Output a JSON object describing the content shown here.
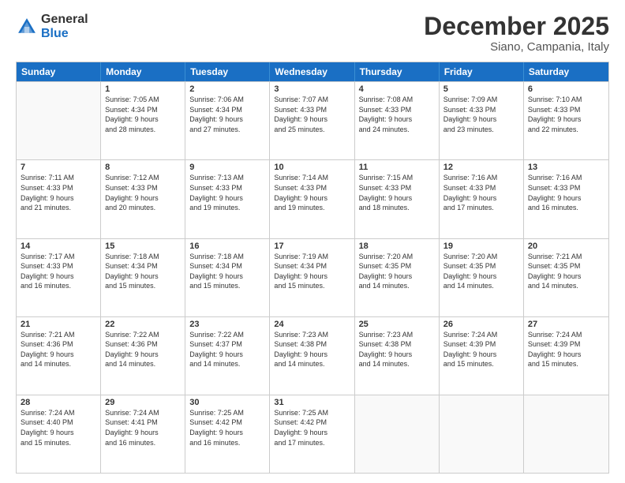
{
  "logo": {
    "general": "General",
    "blue": "Blue"
  },
  "title": "December 2025",
  "subtitle": "Siano, Campania, Italy",
  "days": [
    "Sunday",
    "Monday",
    "Tuesday",
    "Wednesday",
    "Thursday",
    "Friday",
    "Saturday"
  ],
  "rows": [
    [
      {
        "day": "",
        "info": ""
      },
      {
        "day": "1",
        "info": "Sunrise: 7:05 AM\nSunset: 4:34 PM\nDaylight: 9 hours\nand 28 minutes."
      },
      {
        "day": "2",
        "info": "Sunrise: 7:06 AM\nSunset: 4:34 PM\nDaylight: 9 hours\nand 27 minutes."
      },
      {
        "day": "3",
        "info": "Sunrise: 7:07 AM\nSunset: 4:33 PM\nDaylight: 9 hours\nand 25 minutes."
      },
      {
        "day": "4",
        "info": "Sunrise: 7:08 AM\nSunset: 4:33 PM\nDaylight: 9 hours\nand 24 minutes."
      },
      {
        "day": "5",
        "info": "Sunrise: 7:09 AM\nSunset: 4:33 PM\nDaylight: 9 hours\nand 23 minutes."
      },
      {
        "day": "6",
        "info": "Sunrise: 7:10 AM\nSunset: 4:33 PM\nDaylight: 9 hours\nand 22 minutes."
      }
    ],
    [
      {
        "day": "7",
        "info": "Sunrise: 7:11 AM\nSunset: 4:33 PM\nDaylight: 9 hours\nand 21 minutes."
      },
      {
        "day": "8",
        "info": "Sunrise: 7:12 AM\nSunset: 4:33 PM\nDaylight: 9 hours\nand 20 minutes."
      },
      {
        "day": "9",
        "info": "Sunrise: 7:13 AM\nSunset: 4:33 PM\nDaylight: 9 hours\nand 19 minutes."
      },
      {
        "day": "10",
        "info": "Sunrise: 7:14 AM\nSunset: 4:33 PM\nDaylight: 9 hours\nand 19 minutes."
      },
      {
        "day": "11",
        "info": "Sunrise: 7:15 AM\nSunset: 4:33 PM\nDaylight: 9 hours\nand 18 minutes."
      },
      {
        "day": "12",
        "info": "Sunrise: 7:16 AM\nSunset: 4:33 PM\nDaylight: 9 hours\nand 17 minutes."
      },
      {
        "day": "13",
        "info": "Sunrise: 7:16 AM\nSunset: 4:33 PM\nDaylight: 9 hours\nand 16 minutes."
      }
    ],
    [
      {
        "day": "14",
        "info": "Sunrise: 7:17 AM\nSunset: 4:33 PM\nDaylight: 9 hours\nand 16 minutes."
      },
      {
        "day": "15",
        "info": "Sunrise: 7:18 AM\nSunset: 4:34 PM\nDaylight: 9 hours\nand 15 minutes."
      },
      {
        "day": "16",
        "info": "Sunrise: 7:18 AM\nSunset: 4:34 PM\nDaylight: 9 hours\nand 15 minutes."
      },
      {
        "day": "17",
        "info": "Sunrise: 7:19 AM\nSunset: 4:34 PM\nDaylight: 9 hours\nand 15 minutes."
      },
      {
        "day": "18",
        "info": "Sunrise: 7:20 AM\nSunset: 4:35 PM\nDaylight: 9 hours\nand 14 minutes."
      },
      {
        "day": "19",
        "info": "Sunrise: 7:20 AM\nSunset: 4:35 PM\nDaylight: 9 hours\nand 14 minutes."
      },
      {
        "day": "20",
        "info": "Sunrise: 7:21 AM\nSunset: 4:35 PM\nDaylight: 9 hours\nand 14 minutes."
      }
    ],
    [
      {
        "day": "21",
        "info": "Sunrise: 7:21 AM\nSunset: 4:36 PM\nDaylight: 9 hours\nand 14 minutes."
      },
      {
        "day": "22",
        "info": "Sunrise: 7:22 AM\nSunset: 4:36 PM\nDaylight: 9 hours\nand 14 minutes."
      },
      {
        "day": "23",
        "info": "Sunrise: 7:22 AM\nSunset: 4:37 PM\nDaylight: 9 hours\nand 14 minutes."
      },
      {
        "day": "24",
        "info": "Sunrise: 7:23 AM\nSunset: 4:38 PM\nDaylight: 9 hours\nand 14 minutes."
      },
      {
        "day": "25",
        "info": "Sunrise: 7:23 AM\nSunset: 4:38 PM\nDaylight: 9 hours\nand 14 minutes."
      },
      {
        "day": "26",
        "info": "Sunrise: 7:24 AM\nSunset: 4:39 PM\nDaylight: 9 hours\nand 15 minutes."
      },
      {
        "day": "27",
        "info": "Sunrise: 7:24 AM\nSunset: 4:39 PM\nDaylight: 9 hours\nand 15 minutes."
      }
    ],
    [
      {
        "day": "28",
        "info": "Sunrise: 7:24 AM\nSunset: 4:40 PM\nDaylight: 9 hours\nand 15 minutes."
      },
      {
        "day": "29",
        "info": "Sunrise: 7:24 AM\nSunset: 4:41 PM\nDaylight: 9 hours\nand 16 minutes."
      },
      {
        "day": "30",
        "info": "Sunrise: 7:25 AM\nSunset: 4:42 PM\nDaylight: 9 hours\nand 16 minutes."
      },
      {
        "day": "31",
        "info": "Sunrise: 7:25 AM\nSunset: 4:42 PM\nDaylight: 9 hours\nand 17 minutes."
      },
      {
        "day": "",
        "info": ""
      },
      {
        "day": "",
        "info": ""
      },
      {
        "day": "",
        "info": ""
      }
    ]
  ]
}
